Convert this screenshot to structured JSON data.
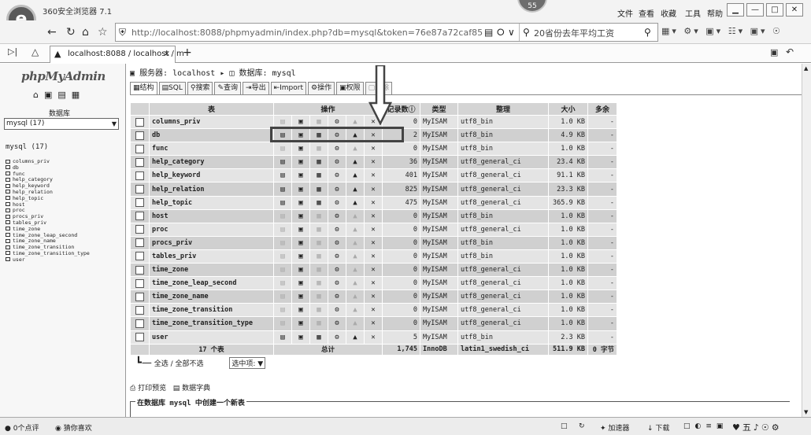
{
  "browser": {
    "title": "360安全浏览器 7.1",
    "badge": "55",
    "menu": [
      "文件",
      "查看",
      "收藏",
      "工具",
      "帮助"
    ],
    "url": "http://localhost:8088/phpmyadmin/index.php?db=mysql&token=76e87a72caf85",
    "search_text": "20省份去年平均工资",
    "tab_title": "localhost:8088 / localhost / m"
  },
  "sidebar": {
    "logo": "phpMyAdmin",
    "db_label": "数据库",
    "db_select": "mysql (17)",
    "db_heading": "mysql (17)",
    "tables": [
      "columns_priv",
      "db",
      "func",
      "help_category",
      "help_keyword",
      "help_relation",
      "help_topic",
      "host",
      "proc",
      "procs_priv",
      "tables_priv",
      "time_zone",
      "time_zone_leap_second",
      "time_zone_name",
      "time_zone_transition",
      "time_zone_transition_type",
      "user"
    ]
  },
  "main": {
    "crumb_server_label": "服务器:",
    "crumb_server": "localhost",
    "crumb_db_label": "数据库:",
    "crumb_db": "mysql",
    "tabs": [
      {
        "label": "结构",
        "state": "active"
      },
      {
        "label": "SQL",
        "state": "normal"
      },
      {
        "label": "搜索",
        "state": "normal"
      },
      {
        "label": "查询",
        "state": "normal"
      },
      {
        "label": "导出",
        "state": "normal"
      },
      {
        "label": "Import",
        "state": "normal"
      },
      {
        "label": "操作",
        "state": "normal"
      },
      {
        "label": "权限",
        "state": "normal"
      },
      {
        "label": "删除",
        "state": "disabled"
      }
    ],
    "headers": {
      "table": "表",
      "actions": "操作",
      "records": "记录数",
      "type": "类型",
      "collation": "整理",
      "size": "大小",
      "overhead": "多余"
    },
    "rows": [
      {
        "name": "columns_priv",
        "records": "0",
        "type": "MyISAM",
        "collation": "utf8_bin",
        "size": "1.0 KB",
        "overhead": "-",
        "empty": true
      },
      {
        "name": "db",
        "records": "2",
        "type": "MyISAM",
        "collation": "utf8_bin",
        "size": "4.9 KB",
        "overhead": "-",
        "empty": false
      },
      {
        "name": "func",
        "records": "0",
        "type": "MyISAM",
        "collation": "utf8_bin",
        "size": "1.0 KB",
        "overhead": "-",
        "empty": true
      },
      {
        "name": "help_category",
        "records": "36",
        "type": "MyISAM",
        "collation": "utf8_general_ci",
        "size": "23.4 KB",
        "overhead": "-",
        "empty": false
      },
      {
        "name": "help_keyword",
        "records": "401",
        "type": "MyISAM",
        "collation": "utf8_general_ci",
        "size": "91.1 KB",
        "overhead": "-",
        "empty": false
      },
      {
        "name": "help_relation",
        "records": "825",
        "type": "MyISAM",
        "collation": "utf8_general_ci",
        "size": "23.3 KB",
        "overhead": "-",
        "empty": false
      },
      {
        "name": "help_topic",
        "records": "475",
        "type": "MyISAM",
        "collation": "utf8_general_ci",
        "size": "365.9 KB",
        "overhead": "-",
        "empty": false
      },
      {
        "name": "host",
        "records": "0",
        "type": "MyISAM",
        "collation": "utf8_bin",
        "size": "1.0 KB",
        "overhead": "-",
        "empty": true
      },
      {
        "name": "proc",
        "records": "0",
        "type": "MyISAM",
        "collation": "utf8_general_ci",
        "size": "1.0 KB",
        "overhead": "-",
        "empty": true
      },
      {
        "name": "procs_priv",
        "records": "0",
        "type": "MyISAM",
        "collation": "utf8_bin",
        "size": "1.0 KB",
        "overhead": "-",
        "empty": true
      },
      {
        "name": "tables_priv",
        "records": "0",
        "type": "MyISAM",
        "collation": "utf8_bin",
        "size": "1.0 KB",
        "overhead": "-",
        "empty": true
      },
      {
        "name": "time_zone",
        "records": "0",
        "type": "MyISAM",
        "collation": "utf8_general_ci",
        "size": "1.0 KB",
        "overhead": "-",
        "empty": true
      },
      {
        "name": "time_zone_leap_second",
        "records": "0",
        "type": "MyISAM",
        "collation": "utf8_general_ci",
        "size": "1.0 KB",
        "overhead": "-",
        "empty": true
      },
      {
        "name": "time_zone_name",
        "records": "0",
        "type": "MyISAM",
        "collation": "utf8_general_ci",
        "size": "1.0 KB",
        "overhead": "-",
        "empty": true
      },
      {
        "name": "time_zone_transition",
        "records": "0",
        "type": "MyISAM",
        "collation": "utf8_general_ci",
        "size": "1.0 KB",
        "overhead": "-",
        "empty": true
      },
      {
        "name": "time_zone_transition_type",
        "records": "0",
        "type": "MyISAM",
        "collation": "utf8_general_ci",
        "size": "1.0 KB",
        "overhead": "-",
        "empty": true
      },
      {
        "name": "user",
        "records": "5",
        "type": "MyISAM",
        "collation": "utf8_bin",
        "size": "2.3 KB",
        "overhead": "-",
        "empty": false
      }
    ],
    "total": {
      "label": "17 个表",
      "sum": "总计",
      "records": "1,745",
      "type": "InnoDB",
      "collation": "latin1_swedish_ci",
      "size": "511.9 KB",
      "overhead": "0 字节"
    },
    "select_all": "全选 / 全部不选",
    "with_selected": "选中项:",
    "print_view": "打印预览",
    "data_dict": "数据字典",
    "create_table": "在数据库 mysql 中创建一个新表"
  },
  "status": {
    "comments": "0个点评",
    "guess": "猜你喜欢",
    "accelerator": "加速器",
    "download": "下载"
  }
}
